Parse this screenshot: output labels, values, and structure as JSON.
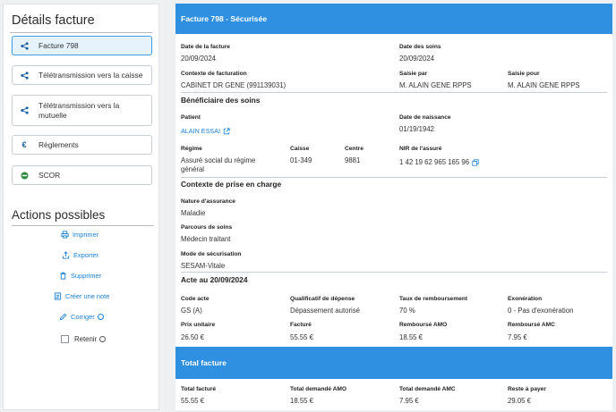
{
  "sidebar": {
    "title": "Détails facture",
    "nav": [
      {
        "label": "Facture 798",
        "icon": "share-icon",
        "active": true
      },
      {
        "label": "Télétransmission vers la caisse",
        "icon": "share-icon"
      },
      {
        "label": "Télétransmission vers la mutuelle",
        "icon": "share-icon"
      },
      {
        "label": "Règlements",
        "icon": "euro-icon"
      },
      {
        "label": "SCOR",
        "icon": "scor-icon"
      }
    ],
    "actions_title": "Actions possibles",
    "actions": {
      "print": "Imprimer",
      "export": "Exporter",
      "delete": "Supprimer",
      "note": "Créer une note",
      "correct": "Corriger",
      "retain": "Retenir"
    }
  },
  "invoice": {
    "header": "Facture 798 - Sécurisée",
    "date_facture_label": "Date de la facture",
    "date_facture": "20/09/2024",
    "date_soins_label": "Date des soins",
    "date_soins": "20/09/2024",
    "contexte_label": "Contexte de facturation",
    "contexte": "CABINET DR GENE (991139031)",
    "saisie_par_label": "Saisie par",
    "saisie_par": "M. ALAIN GENE RPPS",
    "saisie_pour_label": "Saisie pour",
    "saisie_pour": "M. ALAIN GENE RPPS"
  },
  "beneficiaire": {
    "title": "Bénéficiaire des soins",
    "patient_label": "Patient",
    "patient": "ALAIN ESSAI",
    "naissance_label": "Date de naissance",
    "naissance": "01/19/1942",
    "regime_label": "Régime",
    "regime": "Assuré social du régime général",
    "caisse_label": "Caisse",
    "caisse": "01-349",
    "centre_label": "Centre",
    "centre": "9881",
    "nir_label": "NIR de l'assuré",
    "nir": "1 42 19 62 965 165 96"
  },
  "prise_en_charge": {
    "title": "Contexte de prise en charge",
    "nature_label": "Nature d'assurance",
    "nature": "Maladie",
    "parcours_label": "Parcours de soins",
    "parcours": "Médecin traitant",
    "mode_label": "Mode de sécurisation",
    "mode": "SESAM-Vitale"
  },
  "acte": {
    "title": "Acte au 20/09/2024",
    "code_label": "Code acte",
    "code": "GS (A)",
    "qualif_label": "Qualificatif de dépense",
    "qualif": "Dépassement autorisé",
    "taux_label": "Taux de remboursement",
    "taux": "70 %",
    "exo_label": "Exonération",
    "exo": "0 - Pas d'exonération",
    "prix_label": "Prix unitaire",
    "prix": "26.50 €",
    "facture_label": "Facturé",
    "facture": "55.55 €",
    "amo_label": "Remboursé AMO",
    "amo": "18.55 €",
    "amc_label": "Remboursé AMC",
    "amc": "7.95 €"
  },
  "total": {
    "title": "Total facture",
    "facture_label": "Total facturé",
    "facture": "55.55 €",
    "amo_label": "Total demandé AMO",
    "amo": "18.55 €",
    "amc_label": "Total demandé AMC",
    "amc": "7.95 €",
    "reste_label": "Reste à payer",
    "reste": "29.05 €"
  },
  "colors": {
    "accent": "#2f8fe0",
    "link": "#1a7fd4",
    "active_bg": "#e6f3fd"
  }
}
